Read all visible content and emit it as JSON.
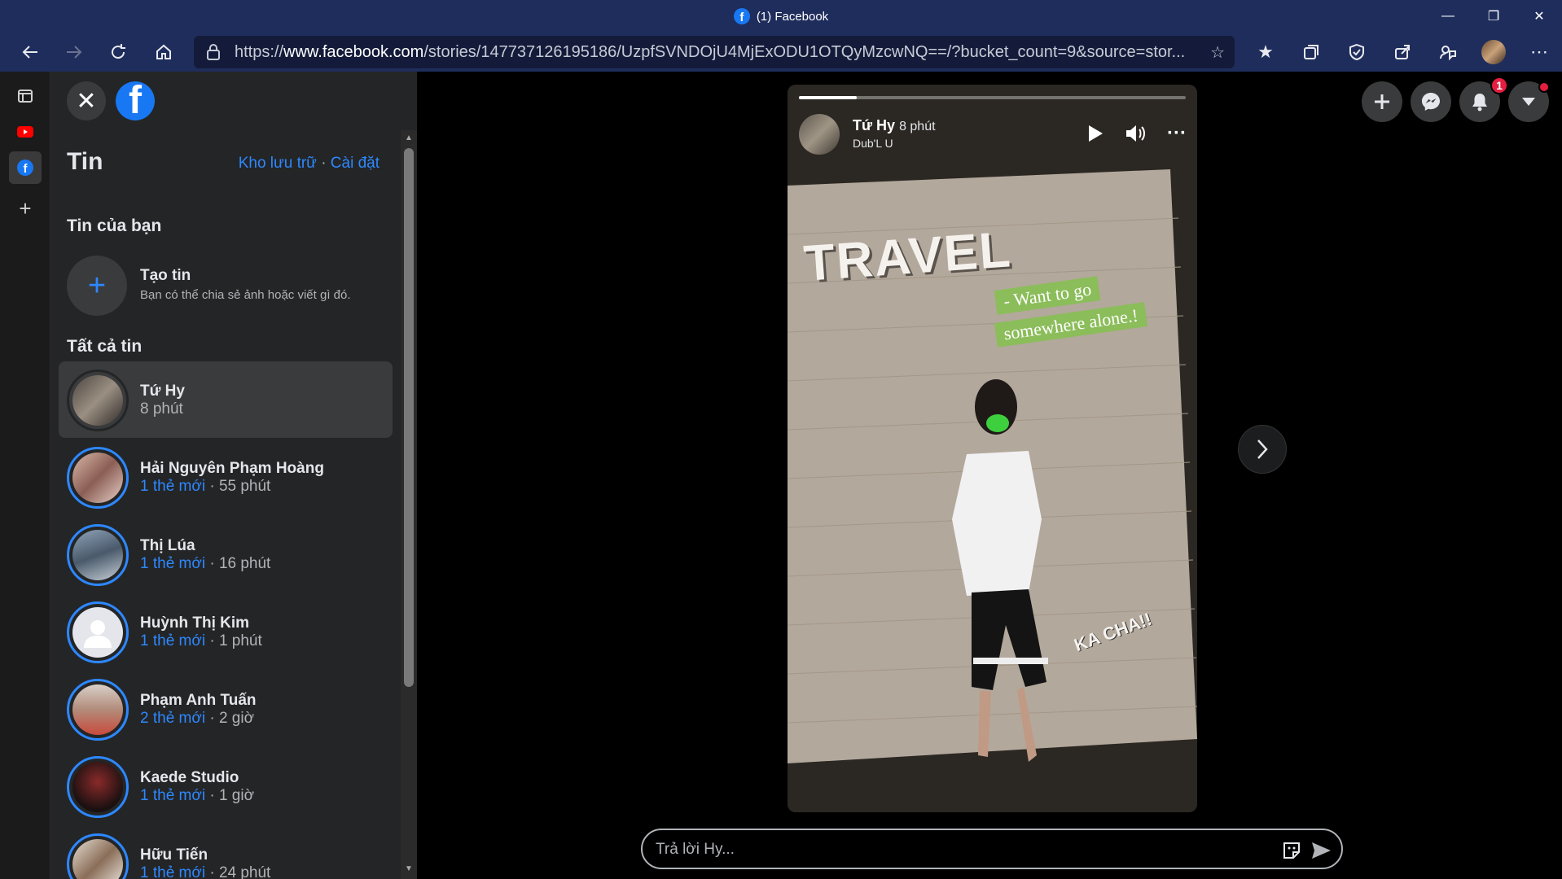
{
  "window": {
    "title": "(1) Facebook"
  },
  "address_bar": {
    "url_prefix": "https://",
    "url_host": "www.facebook.com",
    "url_rest": "/stories/147737126195186/UzpfSVNDOjU4MjExODU1OTQyMzcwNQ==/?bucket_count=9&source=stor..."
  },
  "panel": {
    "heading": "Tin",
    "archive_link": "Kho lưu trữ",
    "separator": "·",
    "settings_link": "Cài đặt",
    "your_story_heading": "Tin của bạn",
    "create_title": "Tạo tin",
    "create_subtitle": "Bạn có thể chia sẻ ảnh hoặc viết gì đó.",
    "all_stories_heading": "Tất cả tin",
    "stories": [
      {
        "name": "Tứ Hy",
        "new": "",
        "sep": "",
        "time": "8 phút"
      },
      {
        "name": "Hải Nguyên Phạm Hoàng",
        "new": "1 thẻ mới",
        "sep": " · ",
        "time": "55 phút"
      },
      {
        "name": "Thị Lúa",
        "new": "1 thẻ mới",
        "sep": " · ",
        "time": "16 phút"
      },
      {
        "name": "Huỳnh Thị Kim",
        "new": "1 thẻ mới",
        "sep": " · ",
        "time": "1 phút"
      },
      {
        "name": "Phạm Anh Tuấn",
        "new": "2 thẻ mới",
        "sep": " · ",
        "time": "2 giờ"
      },
      {
        "name": "Kaede Studio",
        "new": "1 thẻ mới",
        "sep": " · ",
        "time": "1 giờ"
      },
      {
        "name": "Hữu Tiến",
        "new": "1 thẻ mới",
        "sep": " · ",
        "time": "24 phút"
      }
    ]
  },
  "viewer": {
    "author": "Tứ Hy",
    "time": "8 phút",
    "music": "Dub'L U",
    "progress": 0.15,
    "overlay_travel": "TRAVEL",
    "overlay_caption_1": "- Want to go",
    "overlay_caption_2": "somewhere alone.!",
    "overlay_sticker": "KA CHA!!"
  },
  "header": {
    "notification_count": "1"
  },
  "reply": {
    "placeholder": "Trả lời Hy..."
  },
  "colors": {
    "accent": "#2d88ff",
    "panel_bg": "#242526",
    "browser_chrome": "#1f2d5c",
    "badge": "#e41e3f"
  }
}
